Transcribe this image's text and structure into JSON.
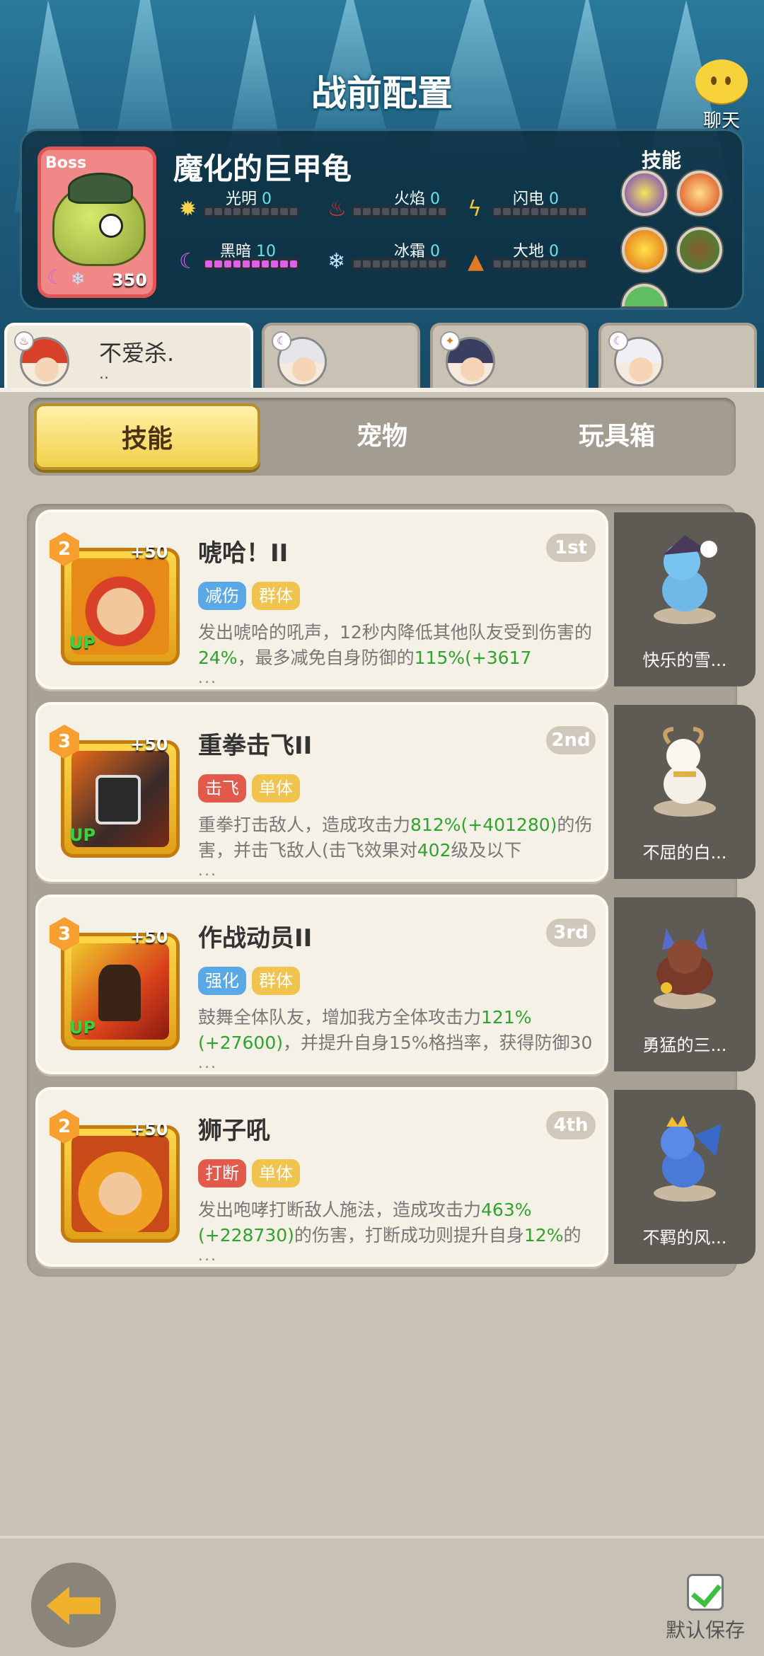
{
  "header": {
    "title": "战前配置",
    "chat_label": "聊天"
  },
  "boss": {
    "tag": "Boss",
    "name": "魔化的巨甲龟",
    "level": "350",
    "skills_label": "技能",
    "elements": [
      {
        "name": "光明",
        "value": "0",
        "icon": "sun-icon",
        "fill": 0
      },
      {
        "name": "火焰",
        "value": "0",
        "icon": "flame-icon",
        "fill": 0
      },
      {
        "name": "闪电",
        "value": "0",
        "icon": "lightning-icon",
        "fill": 0
      },
      {
        "name": "黑暗",
        "value": "10",
        "icon": "moon-icon",
        "fill": 1
      },
      {
        "name": "冰霜",
        "value": "0",
        "icon": "snowflake-icon",
        "fill": 0
      },
      {
        "name": "大地",
        "value": "0",
        "icon": "mountain-icon",
        "fill": 0
      }
    ]
  },
  "heroes": [
    {
      "name": "不爱杀.",
      "sub": "..",
      "selected": true
    },
    {
      "name": "",
      "sub": ""
    },
    {
      "name": "",
      "sub": ""
    },
    {
      "name": "",
      "sub": ""
    }
  ],
  "tabs": [
    {
      "label": "技能",
      "active": true
    },
    {
      "label": "宠物"
    },
    {
      "label": "玩具箱"
    }
  ],
  "skills": [
    {
      "rank": "2",
      "plus": "+50",
      "up": "UP",
      "name": "唬哈！II",
      "order": "1st",
      "tags": [
        {
          "text": "减伤",
          "color": "blue"
        },
        {
          "text": "群体",
          "color": "yellow"
        }
      ],
      "desc_parts": [
        "发出唬哈的吼声，12秒内降低其他队友受到伤害的",
        "24%",
        "，最多减免自身防御的",
        "115%",
        "(+3617"
      ],
      "pet": "快乐的雪..."
    },
    {
      "rank": "3",
      "plus": "+50",
      "up": "UP",
      "name": "重拳击飞II",
      "order": "2nd",
      "tags": [
        {
          "text": "击飞",
          "color": "red"
        },
        {
          "text": "单体",
          "color": "yellow"
        }
      ],
      "desc_parts": [
        "重拳打击敌人，造成攻击力",
        "812%",
        "(+401280)",
        "的伤害，并击飞敌人(击飞效果对",
        "402",
        "级及以下"
      ],
      "pet": "不屈的白..."
    },
    {
      "rank": "3",
      "plus": "+50",
      "up": "UP",
      "name": "作战动员II",
      "order": "3rd",
      "tags": [
        {
          "text": "强化",
          "color": "blue"
        },
        {
          "text": "群体",
          "color": "yellow"
        }
      ],
      "desc_parts": [
        "鼓舞全体队友，增加我方全体攻击力",
        "121%",
        "(+27600)",
        "，并提升自身15%格挡率，获得防御30"
      ],
      "pet": "勇猛的三..."
    },
    {
      "rank": "2",
      "plus": "+50",
      "up": "",
      "name": "狮子吼",
      "order": "4th",
      "tags": [
        {
          "text": "打断",
          "color": "red"
        },
        {
          "text": "单体",
          "color": "yellow"
        }
      ],
      "desc_parts": [
        "发出咆哮打断敌人施法，造成攻击力",
        "463%",
        "(+228730)",
        "的伤害，打断成功则提升自身",
        "12%",
        "的格"
      ],
      "pet": "不羁的风..."
    }
  ],
  "footer": {
    "save_label": "默认保存"
  },
  "colors": {
    "accent": "#f2d04a",
    "green": "#2fa22f",
    "dark_magic": "#e060e8"
  }
}
